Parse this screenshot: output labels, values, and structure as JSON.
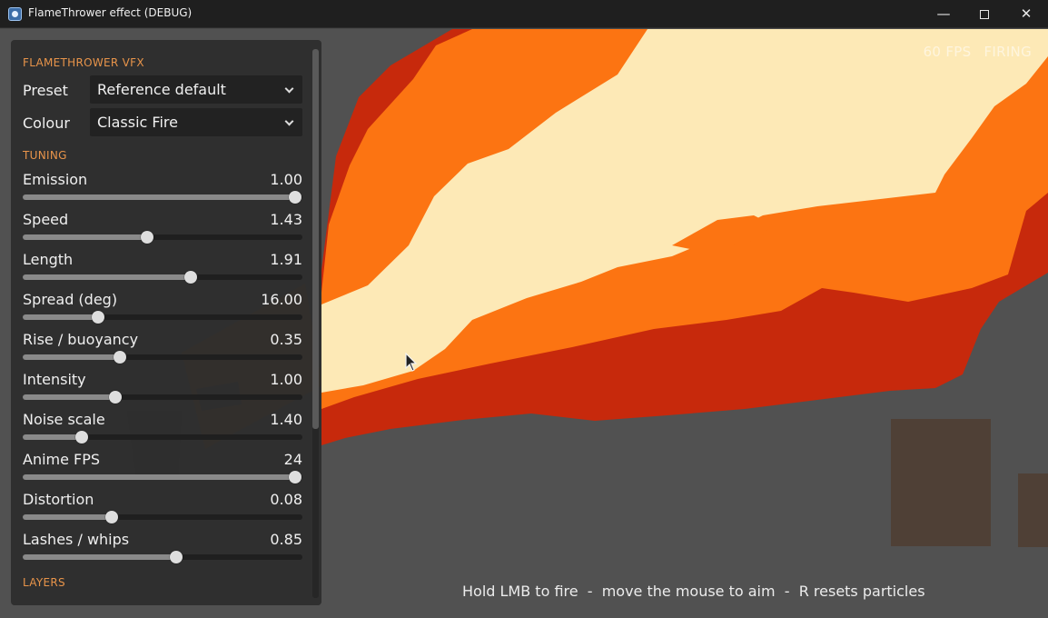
{
  "window": {
    "title": "FlameThrower effect (DEBUG)",
    "min_glyph": "—",
    "close_glyph": "✕"
  },
  "hud": {
    "fps": "60 FPS",
    "state": "FIRING"
  },
  "hint": "Hold LMB to fire  -  move the mouse to aim  -  R resets particles",
  "panel": {
    "title": "FLAMETHROWER VFX",
    "preset": {
      "label": "Preset",
      "value": "Reference default"
    },
    "colour": {
      "label": "Colour",
      "value": "Classic Fire"
    },
    "tuning_title": "TUNING",
    "layers_title": "LAYERS",
    "params": [
      {
        "label": "Emission",
        "value": "1.00",
        "position": 1.0
      },
      {
        "label": "Speed",
        "value": "1.43",
        "position": 0.455
      },
      {
        "label": "Length",
        "value": "1.91",
        "position": 0.617
      },
      {
        "label": "Spread (deg)",
        "value": "16.00",
        "position": 0.276
      },
      {
        "label": "Rise / buoyancy",
        "value": "0.35",
        "position": 0.357
      },
      {
        "label": "Intensity",
        "value": "1.00",
        "position": 0.341
      },
      {
        "label": "Noise scale",
        "value": "1.40",
        "position": 0.218
      },
      {
        "label": "Anime FPS",
        "value": "24",
        "position": 1.0
      },
      {
        "label": "Distortion",
        "value": "0.08",
        "position": 0.328
      },
      {
        "label": "Lashes / whips",
        "value": "0.85",
        "position": 0.562
      }
    ]
  },
  "colors": {
    "section_accent": "#e8944a",
    "flame_outer": "#c7290c",
    "flame_mid": "#fc7412",
    "flame_core": "#fde9b6"
  },
  "icons": [
    "app-icon",
    "minimize-icon",
    "maximize-icon",
    "close-icon",
    "chevron-down-icon",
    "mouse-cursor-icon"
  ]
}
